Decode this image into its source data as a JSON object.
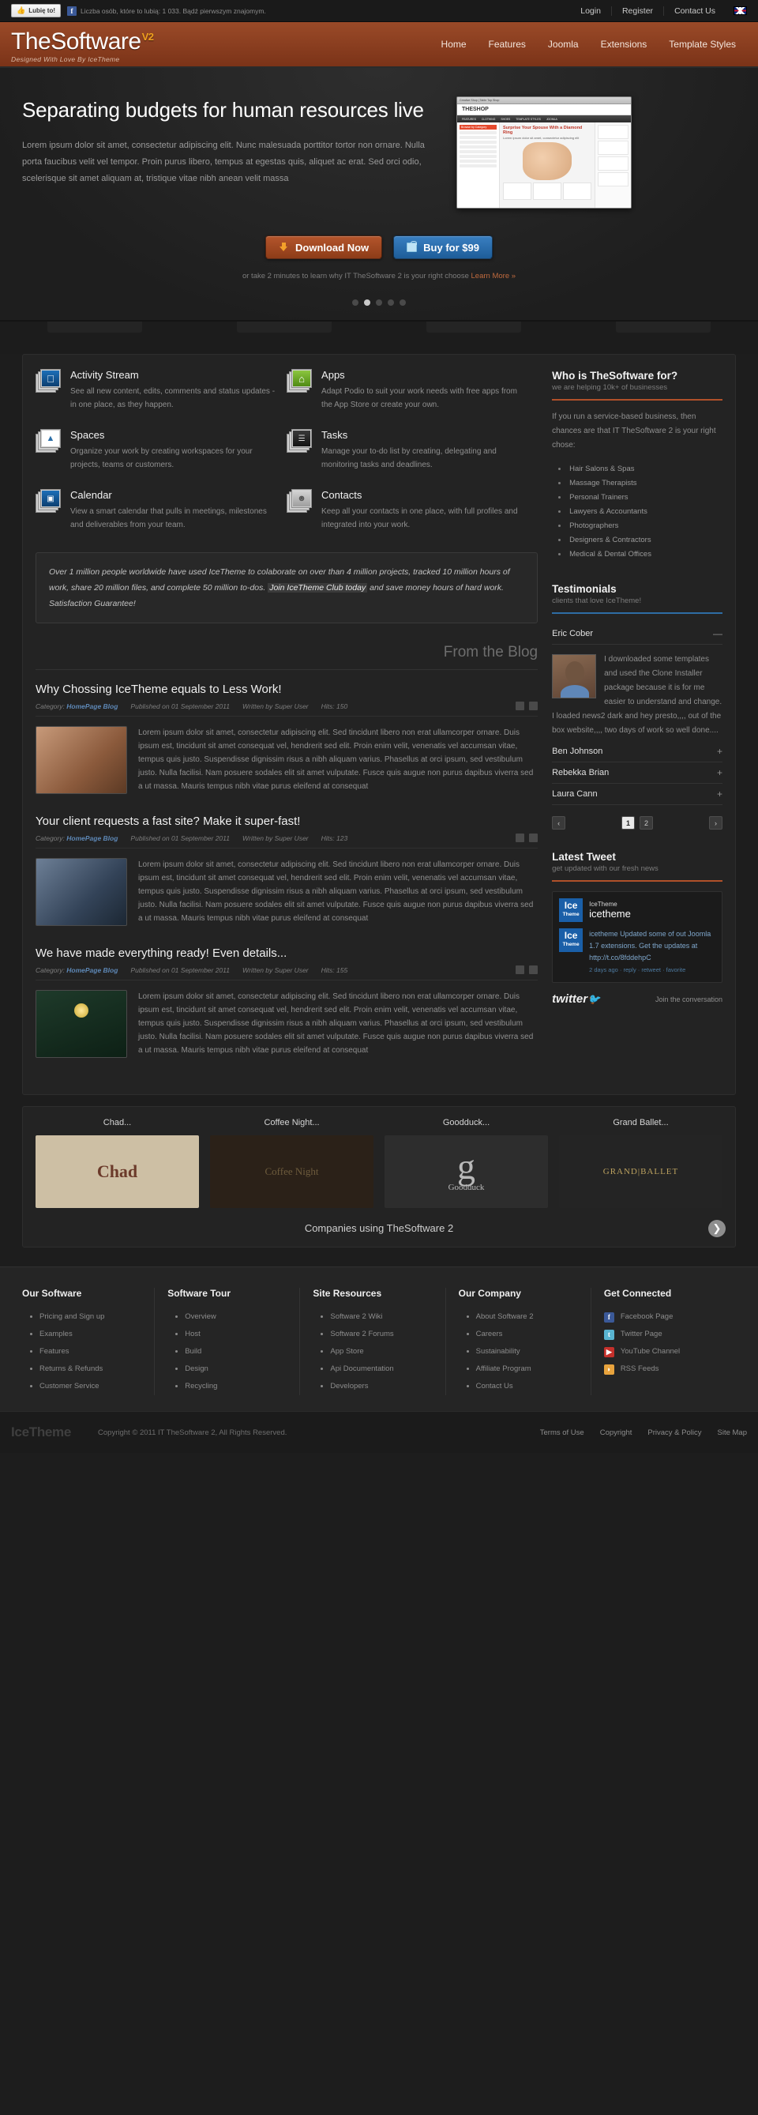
{
  "topbar": {
    "like_label": "Lubię to!",
    "fb_badge": "f",
    "fb_count_text": "Liczba osób, które to lubią: 1 033. Bądź pierwszym znajomym.",
    "links": [
      "Login",
      "Register",
      "Contact Us"
    ],
    "flag_name": "uk-flag"
  },
  "header": {
    "logo": "TheSoftware",
    "logo_sup": "V2",
    "tagline": "Designed With Love By IceTheme",
    "nav": [
      "Home",
      "Features",
      "Joomla",
      "Extensions",
      "Template Styles"
    ]
  },
  "hero": {
    "title": "Separating budgets for human resources live",
    "paragraph": "Lorem ipsum dolor sit amet, consectetur adipiscing elit. Nunc malesuada porttitor tortor non ornare. Nulla porta faucibus velit vel tempor. Proin purus libero, tempus at egestas quis, aliquet ac erat. Sed orci odio, scelerisque sit amet aliquam at, tristique vitae nibh anean velit massa",
    "btn_download": "Download Now",
    "btn_buy": "Buy for $99",
    "note": "or take 2 minutes to learn why IT TheSoftware 2 is your right choose",
    "note_link": "Learn More »",
    "slides": 5,
    "active_slide": 2,
    "shot": {
      "brand": "THESHOP",
      "browser_title": "Creative Shop | Table Top Shop",
      "nav": [
        "FEATURES",
        "CLOTHING",
        "SHOES",
        "TEMPLATE STYLES",
        "JOOMLA",
        "HOUSEWARES"
      ],
      "side_title": "Browse by Category",
      "headline": "Surprise Your Spouse With a Diamond Ring",
      "subline": "Lorem ipsum dolor sit amet, consectetur adipiscing elit"
    }
  },
  "features": [
    {
      "title": "Activity Stream",
      "icon": "monitor-apple-icon",
      "glyph": "",
      "text": "See all new content, edits, comments and status updates - in one place, as they happen."
    },
    {
      "title": "Apps",
      "icon": "monitor-home-icon",
      "glyph": "⌂",
      "text": "Adapt Podio to suit your work needs with free apps from the App Store or create your own."
    },
    {
      "title": "Spaces",
      "icon": "monitor-document-icon",
      "glyph": "",
      "text": "Organize your work by creating workspaces for your projects, teams or customers."
    },
    {
      "title": "Tasks",
      "icon": "monitor-tasks-icon",
      "glyph": "",
      "text": "Manage your to-do list by creating, delegating and monitoring tasks and deadlines."
    },
    {
      "title": "Calendar",
      "icon": "monitor-calendar-icon",
      "glyph": "",
      "text": "View a smart calendar that pulls in meetings, milestones and deliverables from your team."
    },
    {
      "title": "Contacts",
      "icon": "monitor-contacts-icon",
      "glyph": "",
      "text": "Keep all your contacts in one place, with full profiles and integrated into your work."
    }
  ],
  "quote": {
    "part1": "Over 1 million people worldwide have used IceTheme to colaborate on over than 4 million projects, tracked 10 million hours of work, share 20 million files, and complete 50 million to-dos. ",
    "highlight": "Join IceTheme Club today",
    "part2": " and save money hours of hard work. Satisfaction Guarantee!"
  },
  "blog": {
    "heading": "From the Blog",
    "meta_labels": {
      "category": "Category:",
      "published": "Published on",
      "written": "Written by",
      "hits": "Hits:"
    },
    "posts": [
      {
        "title": "Why Chossing IceTheme equals to Less Work!",
        "category": "HomePage Blog",
        "date": "01 September 2011",
        "author": "Super User",
        "hits": "150",
        "thumb": "hands-together-photo",
        "body": "Lorem ipsum dolor sit amet, consectetur adipiscing elit. Sed tincidunt libero non erat ullamcorper ornare. Duis ipsum est, tincidunt sit amet consequat vel, hendrerit sed elit. Proin enim velit, venenatis vel accumsan vitae, tempus quis justo. Suspendisse dignissim risus a nibh aliquam varius. Phasellus at orci ipsum, sed vestibulum justo. Nulla facilisi. Nam posuere sodales elit sit amet vulputate. Fusce quis augue non purus dapibus viverra sed a ut massa. Mauris tempus nibh vitae purus eleifend at consequat"
      },
      {
        "title": "Your client requests a fast site? Make it super-fast!",
        "category": "HomePage Blog",
        "date": "01 September 2011",
        "author": "Super User",
        "hits": "123",
        "thumb": "high-five-photo",
        "body": "Lorem ipsum dolor sit amet, consectetur adipiscing elit. Sed tincidunt libero non erat ullamcorper ornare. Duis ipsum est, tincidunt sit amet consequat vel, hendrerit sed elit. Proin enim velit, venenatis vel accumsan vitae, tempus quis justo. Suspendisse dignissim risus a nibh aliquam varius. Phasellus at orci ipsum, sed vestibulum justo. Nulla facilisi. Nam posuere sodales elit sit amet vulputate. Fusce quis augue non purus dapibus viverra sed a ut massa. Mauris tempus nibh vitae purus eleifend at consequat"
      },
      {
        "title": "We have made everything ready! Even details...",
        "category": "HomePage Blog",
        "date": "01 September 2011",
        "author": "Super User",
        "hits": "155",
        "thumb": "blackboard-idea-photo",
        "body": "Lorem ipsum dolor sit amet, consectetur adipiscing elit. Sed tincidunt libero non erat ullamcorper ornare. Duis ipsum est, tincidunt sit amet consequat vel, hendrerit sed elit. Proin enim velit, venenatis vel accumsan vitae, tempus quis justo. Suspendisse dignissim risus a nibh aliquam varius. Phasellus at orci ipsum, sed vestibulum justo. Nulla facilisi. Nam posuere sodales elit sit amet vulputate. Fusce quis augue non purus dapibus viverra sed a ut massa. Mauris tempus nibh vitae purus eleifend at consequat"
      }
    ]
  },
  "sidebar": {
    "who": {
      "title": "Who is TheSoftware for?",
      "subtitle": "we are helping 10k+ of businesses",
      "body": "If you run a service-based business, then chances are that IT TheSoftware 2 is your right chose:",
      "items": [
        "Hair Salons & Spas",
        "Massage Therapists",
        "Personal Trainers",
        "Lawyers & Accountants",
        "Photographers",
        "Designers & Contractors",
        "Medical & Dental Offices"
      ]
    },
    "testimonials": {
      "title": "Testimonials",
      "subtitle": "clients that love IceTheme!",
      "open": {
        "name": "Eric Cober",
        "toggle": "—",
        "text": "I downloaded some templates and used the Clone Installer package because it is for me easier to understand and change. I loaded news2 dark and hey presto,,,, out of the box website,,,, two days of work so well done...."
      },
      "collapsed": [
        {
          "name": "Ben Johnson",
          "toggle": "+"
        },
        {
          "name": "Rebekka Brian",
          "toggle": "+"
        },
        {
          "name": "Laura Cann",
          "toggle": "+"
        }
      ],
      "pager": {
        "prev": "‹",
        "next": "›",
        "pages": [
          "1",
          "2"
        ],
        "active": "1"
      }
    },
    "tweet": {
      "title": "Latest Tweet",
      "subtitle": "get updated with our fresh news",
      "logo_line1": "Ice",
      "logo_line2": "Theme",
      "account_name": "IceTheme",
      "account_handle": "icetheme",
      "text": "icetheme Updated some of out Joomla 1.7 extensions. Get the updates at http://t.co/8fddehpC",
      "meta": "2 days ago · reply · retweet · favorite",
      "footer_word": "twitter",
      "footer_join": "Join the conversation"
    }
  },
  "clients": {
    "items": [
      {
        "name": "Chad...",
        "logo_text": "Chad",
        "logo_kind": "chad-logo"
      },
      {
        "name": "Coffee Night...",
        "logo_text": "Coffee Night",
        "logo_kind": "coffee-night-logo"
      },
      {
        "name": "Goodduck...",
        "logo_text": "Goodduck",
        "logo_kind": "goodduck-logo"
      },
      {
        "name": "Grand Ballet...",
        "logo_text": "GRAND|BALLET",
        "logo_kind": "grand-ballet-logo"
      }
    ],
    "caption": "Companies using TheSoftware 2",
    "next": "❯"
  },
  "footer": {
    "columns": [
      {
        "title": "Our Software",
        "links": [
          "Pricing and Sign up",
          "Examples",
          "Features",
          "Returns & Refunds",
          "Customer Service"
        ]
      },
      {
        "title": "Software Tour",
        "links": [
          "Overview",
          "Host",
          "Build",
          "Design",
          "Recycling"
        ]
      },
      {
        "title": "Site Resources",
        "links": [
          "Software 2 Wiki",
          "Software 2 Forums",
          "App Store",
          "Api Documentation",
          "Developers"
        ]
      },
      {
        "title": "Our Company",
        "links": [
          "About Software 2",
          "Careers",
          "Sustainability",
          "Affiliate Program",
          "Contact Us"
        ]
      }
    ],
    "social": {
      "title": "Get Connected",
      "links": [
        {
          "label": "Facebook Page",
          "icon": "facebook-icon",
          "glyph": "f",
          "color": "#3b5998"
        },
        {
          "label": "Twitter Page",
          "icon": "twitter-icon",
          "glyph": "t",
          "color": "#59b4d1"
        },
        {
          "label": "YouTube Channel",
          "icon": "youtube-icon",
          "glyph": "▶",
          "color": "#c4302b"
        },
        {
          "label": "RSS Feeds",
          "icon": "rss-icon",
          "glyph": "◗",
          "color": "#e8a33d"
        }
      ]
    }
  },
  "bottombar": {
    "logo": "IceTheme",
    "copyright": "Copyright © 2011 IT TheSoftware 2, All Rights Reserved.",
    "links": [
      "Terms of Use",
      "Copyright",
      "Privacy & Policy",
      "Site Map"
    ]
  },
  "colors": {
    "brand_orange": "#8d3c18",
    "accent_blue": "#2e6da4",
    "rule_orange": "#b0512a",
    "page_bg": "#1d1d1d",
    "panel_bg": "#232323"
  }
}
